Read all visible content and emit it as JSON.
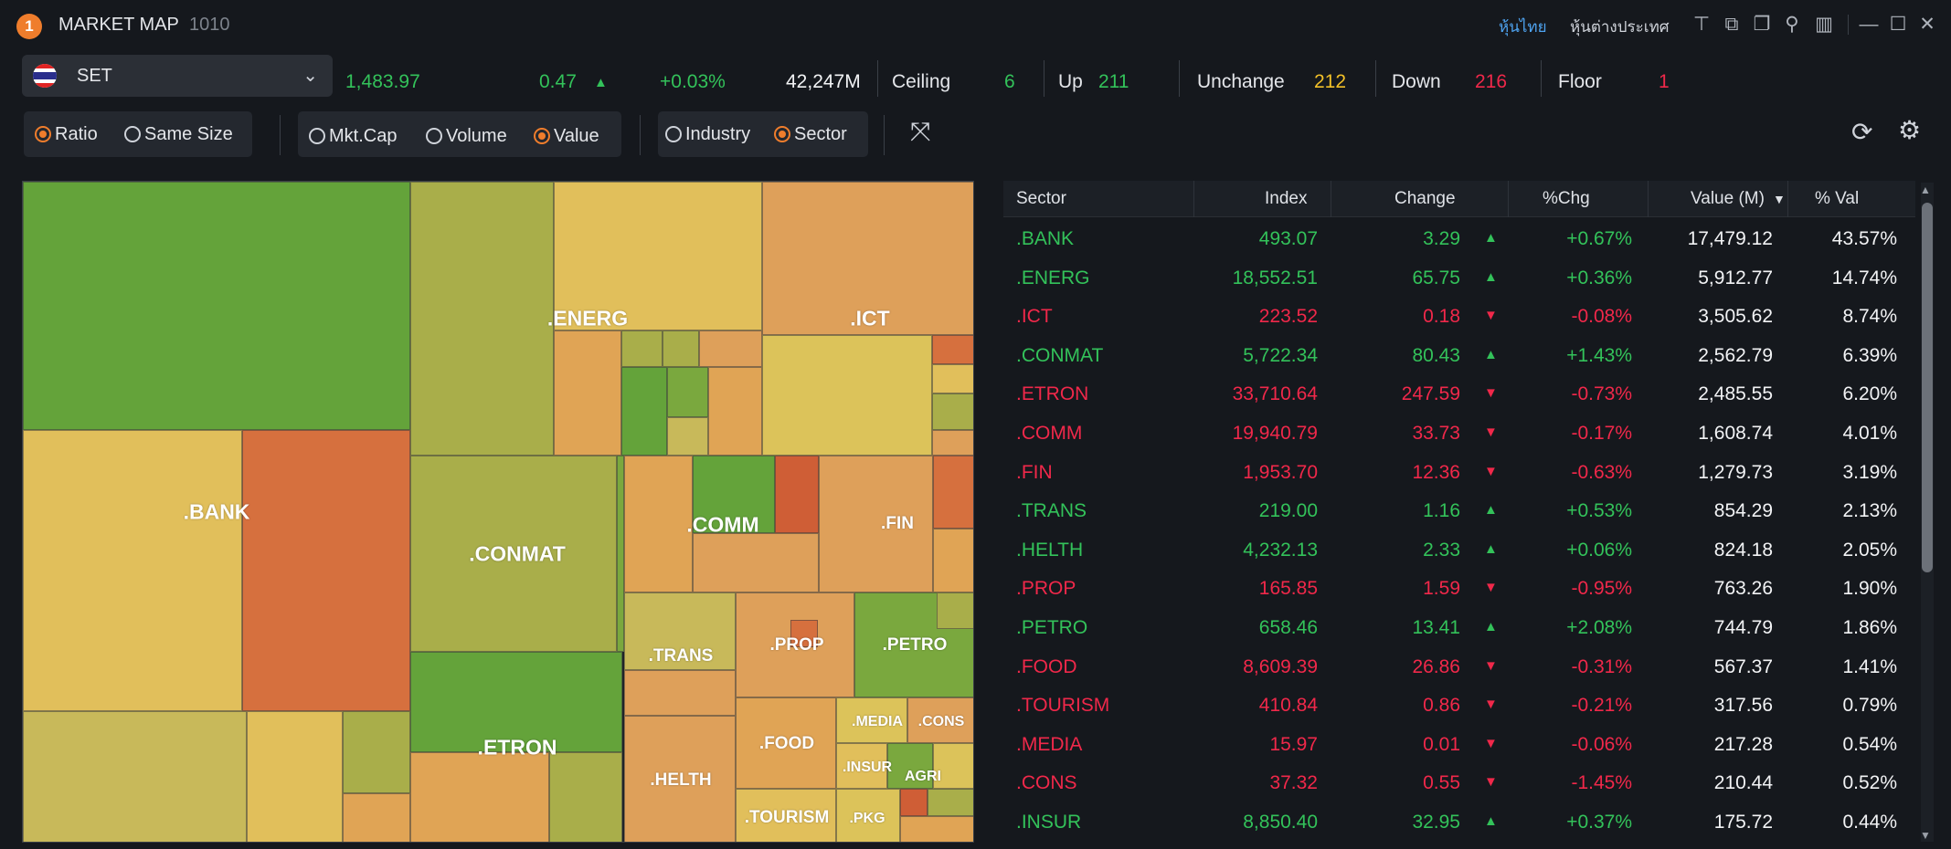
{
  "titlebar": {
    "badge": "1",
    "title": "MARKET MAP",
    "code": "1010",
    "links": [
      "หุ้นไทย",
      "หุ้นต่างประเทศ"
    ],
    "window_buttons": [
      "—",
      "☐",
      "✕"
    ]
  },
  "market": {
    "selected": "SET",
    "index": "1,483.97",
    "change": "0.47",
    "pct": "+0.03%",
    "value": "42,247M",
    "ceiling_label": "Ceiling",
    "ceiling": "6",
    "up_label": "Up",
    "up": "211",
    "unchange_label": "Unchange",
    "unchange": "212",
    "down_label": "Down",
    "down": "216",
    "floor_label": "Floor",
    "floor": "1"
  },
  "options": {
    "size_mode": [
      "Ratio",
      "Same Size"
    ],
    "metric": [
      "Mkt.Cap",
      "Volume",
      "Value"
    ],
    "grouping": [
      "Industry",
      "Sector"
    ]
  },
  "treemap_labels": [
    ".BANK",
    ".ENERG",
    ".ICT",
    ".CONMAT",
    ".COMM",
    ".FIN",
    ".TRANS",
    ".PROP",
    ".PETRO",
    ".ETRON",
    ".HELTH",
    ".FOOD",
    ".MEDIA",
    ".CONS",
    ".INSUR",
    "AGRI",
    ".TOURISM",
    ".PKG"
  ],
  "table": {
    "headers": [
      "Sector",
      "Index",
      "Change",
      "%Chg",
      "Value (M)",
      "% Val"
    ],
    "rows": [
      {
        "sector": ".BANK",
        "index": "493.07",
        "change": "3.29",
        "dir": "up",
        "pct": "+0.67%",
        "value": "17,479.12",
        "pval": "43.57%"
      },
      {
        "sector": ".ENERG",
        "index": "18,552.51",
        "change": "65.75",
        "dir": "up",
        "pct": "+0.36%",
        "value": "5,912.77",
        "pval": "14.74%"
      },
      {
        "sector": ".ICT",
        "index": "223.52",
        "change": "0.18",
        "dir": "down",
        "pct": "-0.08%",
        "value": "3,505.62",
        "pval": "8.74%"
      },
      {
        "sector": ".CONMAT",
        "index": "5,722.34",
        "change": "80.43",
        "dir": "up",
        "pct": "+1.43%",
        "value": "2,562.79",
        "pval": "6.39%"
      },
      {
        "sector": ".ETRON",
        "index": "33,710.64",
        "change": "247.59",
        "dir": "down",
        "pct": "-0.73%",
        "value": "2,485.55",
        "pval": "6.20%"
      },
      {
        "sector": ".COMM",
        "index": "19,940.79",
        "change": "33.73",
        "dir": "down",
        "pct": "-0.17%",
        "value": "1,608.74",
        "pval": "4.01%"
      },
      {
        "sector": ".FIN",
        "index": "1,953.70",
        "change": "12.36",
        "dir": "down",
        "pct": "-0.63%",
        "value": "1,279.73",
        "pval": "3.19%"
      },
      {
        "sector": ".TRANS",
        "index": "219.00",
        "change": "1.16",
        "dir": "up",
        "pct": "+0.53%",
        "value": "854.29",
        "pval": "2.13%"
      },
      {
        "sector": ".HELTH",
        "index": "4,232.13",
        "change": "2.33",
        "dir": "up",
        "pct": "+0.06%",
        "value": "824.18",
        "pval": "2.05%"
      },
      {
        "sector": ".PROP",
        "index": "165.85",
        "change": "1.59",
        "dir": "down",
        "pct": "-0.95%",
        "value": "763.26",
        "pval": "1.90%"
      },
      {
        "sector": ".PETRO",
        "index": "658.46",
        "change": "13.41",
        "dir": "up",
        "pct": "+2.08%",
        "value": "744.79",
        "pval": "1.86%"
      },
      {
        "sector": ".FOOD",
        "index": "8,609.39",
        "change": "26.86",
        "dir": "down",
        "pct": "-0.31%",
        "value": "567.37",
        "pval": "1.41%"
      },
      {
        "sector": ".TOURISM",
        "index": "410.84",
        "change": "0.86",
        "dir": "down",
        "pct": "-0.21%",
        "value": "317.56",
        "pval": "0.79%"
      },
      {
        "sector": ".MEDIA",
        "index": "15.97",
        "change": "0.01",
        "dir": "down",
        "pct": "-0.06%",
        "value": "217.28",
        "pval": "0.54%"
      },
      {
        "sector": ".CONS",
        "index": "37.32",
        "change": "0.55",
        "dir": "down",
        "pct": "-1.45%",
        "value": "210.44",
        "pval": "0.52%"
      },
      {
        "sector": ".INSUR",
        "index": "8,850.40",
        "change": "32.95",
        "dir": "up",
        "pct": "+0.37%",
        "value": "175.72",
        "pval": "0.44%"
      }
    ]
  },
  "colors": {
    "up": "#33c25a",
    "down": "#f0284a",
    "unchanged": "#f2c028",
    "accent": "#ef7d2c"
  }
}
